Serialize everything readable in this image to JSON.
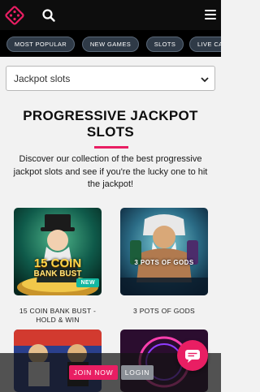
{
  "header": {
    "logo_icon": "dice-logo-icon",
    "search_icon": "search-icon",
    "menu_icon": "hamburger-menu-icon"
  },
  "categories": [
    {
      "label": "MOST POPULAR"
    },
    {
      "label": "NEW GAMES"
    },
    {
      "label": "SLOTS"
    },
    {
      "label": "LIVE CA"
    }
  ],
  "filter": {
    "selected": "Jackpot slots",
    "chevron_icon": "chevron-down-icon"
  },
  "content": {
    "title_line1": "PROGRESSIVE JACKPOT",
    "title_line2": "SLOTS",
    "intro": "Discover our collection of the best progressive jackpot slots and see if you're the lucky one to hit the jackpot!",
    "games": [
      {
        "name": "15 COIN BANK BUST - HOLD & WIN",
        "art_text_1": "15 COIN",
        "art_text_2": "BANK BUST",
        "badge": "NEW"
      },
      {
        "name": "3 POTS OF GODS",
        "art_text_1": "3 POTS OF GODS"
      }
    ]
  },
  "footer": {
    "join_label": "JOIN NOW",
    "login_label": "LOGIN",
    "chat_icon": "chat-bubble-icon"
  },
  "colors": {
    "accent": "#e91e63",
    "topbar": "#0d0d0d",
    "pill_bg": "#2f3a47",
    "new_badge": "#13b7a0"
  }
}
